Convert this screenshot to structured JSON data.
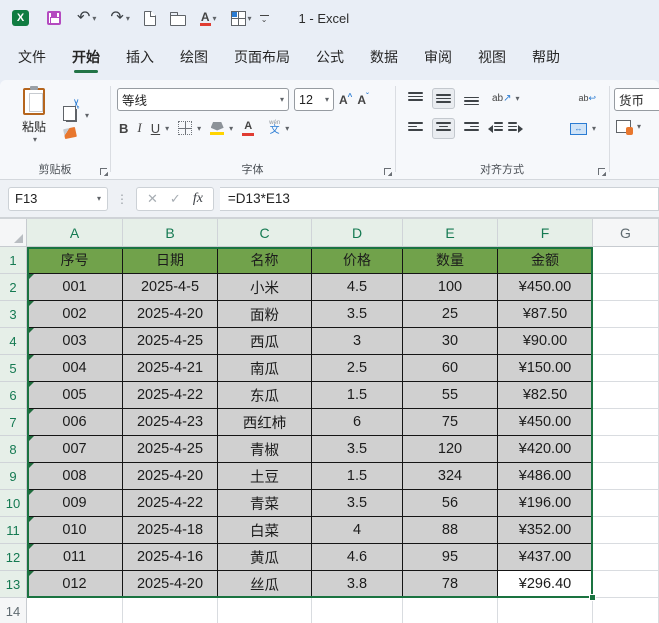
{
  "titlebar": {
    "title": "1 - Excel"
  },
  "menubar": {
    "tabs": [
      {
        "label": "文件",
        "active": false
      },
      {
        "label": "开始",
        "active": true
      },
      {
        "label": "插入",
        "active": false
      },
      {
        "label": "绘图",
        "active": false
      },
      {
        "label": "页面布局",
        "active": false
      },
      {
        "label": "公式",
        "active": false
      },
      {
        "label": "数据",
        "active": false
      },
      {
        "label": "审阅",
        "active": false
      },
      {
        "label": "视图",
        "active": false
      },
      {
        "label": "帮助",
        "active": false
      }
    ]
  },
  "ribbon": {
    "clipboard": {
      "paste_label": "粘贴",
      "group_label": "剪贴板"
    },
    "font": {
      "font_name": "等线",
      "font_size": "12",
      "bold": "B",
      "italic": "I",
      "underline": "U",
      "phonetic_top": "wén",
      "phonetic_bottom": "文",
      "group_label": "字体"
    },
    "alignment": {
      "group_label": "对齐方式",
      "orientation_text": "ab",
      "wrap_text": "ab"
    },
    "number": {
      "format_name": "货币"
    }
  },
  "formula_bar": {
    "name_box": "F13",
    "cancel": "✕",
    "enter": "✓",
    "fx": "fx",
    "formula": "=D13*E13"
  },
  "grid": {
    "column_headers": [
      "A",
      "B",
      "C",
      "D",
      "E",
      "F",
      "G"
    ],
    "selected_columns": [
      "A",
      "B",
      "C",
      "D",
      "E",
      "F"
    ],
    "row_headers": [
      "1",
      "2",
      "3",
      "4",
      "5",
      "6",
      "7",
      "8",
      "9",
      "10",
      "11",
      "12",
      "13",
      "14"
    ],
    "selected_rows": [
      "1",
      "2",
      "3",
      "4",
      "5",
      "6",
      "7",
      "8",
      "9",
      "10",
      "11",
      "12",
      "13"
    ],
    "header_row": [
      "序号",
      "日期",
      "名称",
      "价格",
      "数量",
      "金额"
    ],
    "rows": [
      [
        "001",
        "2025-4-5",
        "小米",
        "4.5",
        "100",
        "¥450.00"
      ],
      [
        "002",
        "2025-4-20",
        "面粉",
        "3.5",
        "25",
        "¥87.50"
      ],
      [
        "003",
        "2025-4-25",
        "西瓜",
        "3",
        "30",
        "¥90.00"
      ],
      [
        "004",
        "2025-4-21",
        "南瓜",
        "2.5",
        "60",
        "¥150.00"
      ],
      [
        "005",
        "2025-4-22",
        "东瓜",
        "1.5",
        "55",
        "¥82.50"
      ],
      [
        "006",
        "2025-4-23",
        "西红柿",
        "6",
        "75",
        "¥450.00"
      ],
      [
        "007",
        "2025-4-25",
        "青椒",
        "3.5",
        "120",
        "¥420.00"
      ],
      [
        "008",
        "2025-4-20",
        "土豆",
        "1.5",
        "324",
        "¥486.00"
      ],
      [
        "009",
        "2025-4-22",
        "青菜",
        "3.5",
        "56",
        "¥196.00"
      ],
      [
        "010",
        "2025-4-18",
        "白菜",
        "4",
        "88",
        "¥352.00"
      ],
      [
        "011",
        "2025-4-16",
        "黄瓜",
        "4.6",
        "95",
        "¥437.00"
      ],
      [
        "012",
        "2025-4-20",
        "丝瓜",
        "3.8",
        "78",
        "¥296.40"
      ]
    ],
    "active_cell": "F13"
  },
  "colors": {
    "accent_green": "#217346",
    "header_fill": "#71a24b",
    "selection_fill": "#d0d0d0",
    "save_icon": "#b44ac0"
  }
}
